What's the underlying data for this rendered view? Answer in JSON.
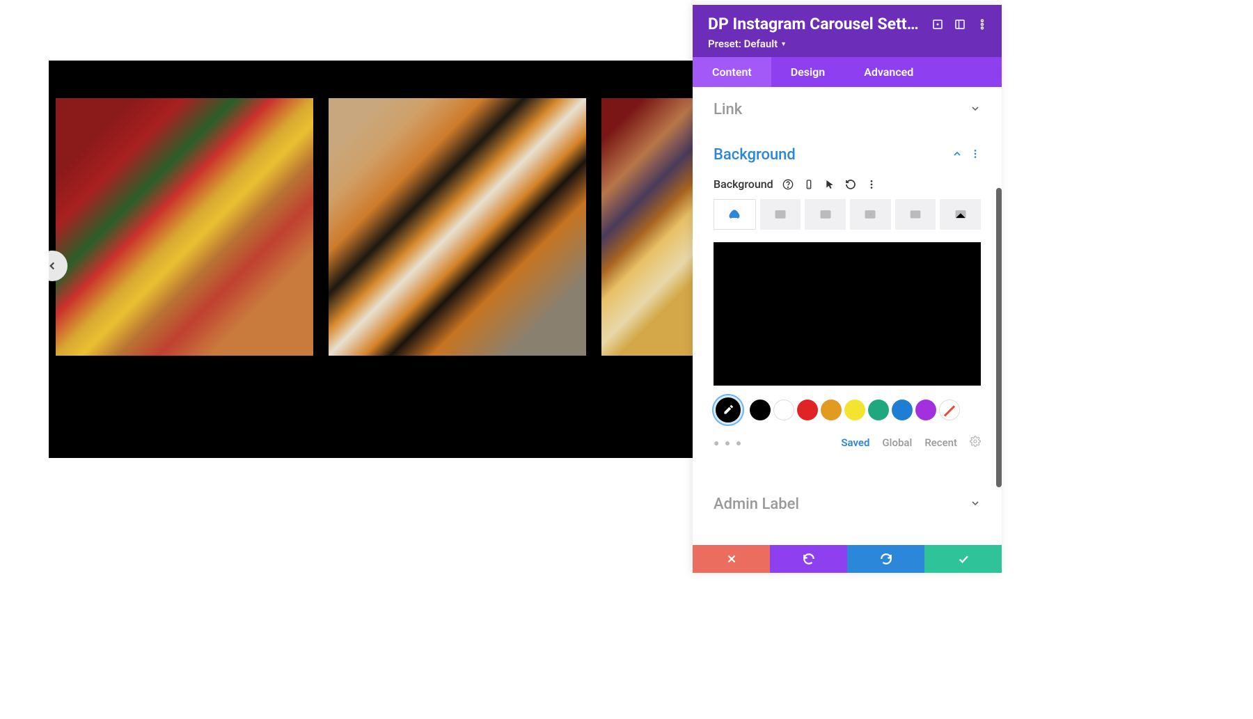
{
  "preview": {
    "background_color": "#000000"
  },
  "panel": {
    "title": "DP Instagram Carousel Setti…",
    "preset_text": "Preset: Default",
    "tabs": [
      {
        "key": "content",
        "label": "Content"
      },
      {
        "key": "design",
        "label": "Design"
      },
      {
        "key": "advanced",
        "label": "Advanced"
      }
    ],
    "sections": {
      "link": {
        "title": "Link"
      },
      "background": {
        "title": "Background",
        "label": "Background",
        "preview_color": "#000000",
        "swatches": [
          {
            "name": "black",
            "color": "#000000"
          },
          {
            "name": "white",
            "color": "#ffffff",
            "border": true
          },
          {
            "name": "red",
            "color": "#e02424"
          },
          {
            "name": "orange",
            "color": "#e09b20"
          },
          {
            "name": "yellow",
            "color": "#f4e430"
          },
          {
            "name": "green",
            "color": "#1fa77e"
          },
          {
            "name": "blue",
            "color": "#1f7dd4"
          },
          {
            "name": "purple",
            "color": "#a330df"
          }
        ],
        "palette_tabs": {
          "saved": "Saved",
          "global": "Global",
          "recent": "Recent"
        }
      },
      "admin": {
        "title": "Admin Label"
      }
    }
  }
}
